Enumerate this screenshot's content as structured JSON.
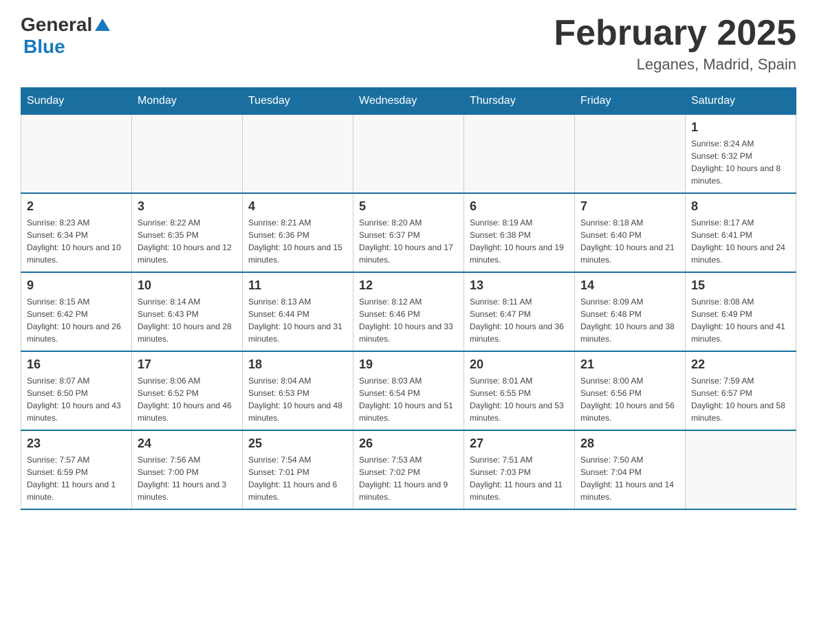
{
  "header": {
    "logo_general": "General",
    "logo_blue": "Blue",
    "month_title": "February 2025",
    "location": "Leganes, Madrid, Spain"
  },
  "days_of_week": [
    "Sunday",
    "Monday",
    "Tuesday",
    "Wednesday",
    "Thursday",
    "Friday",
    "Saturday"
  ],
  "weeks": [
    {
      "cells": [
        {
          "day": "",
          "info": ""
        },
        {
          "day": "",
          "info": ""
        },
        {
          "day": "",
          "info": ""
        },
        {
          "day": "",
          "info": ""
        },
        {
          "day": "",
          "info": ""
        },
        {
          "day": "",
          "info": ""
        },
        {
          "day": "1",
          "info": "Sunrise: 8:24 AM\nSunset: 6:32 PM\nDaylight: 10 hours and 8 minutes."
        }
      ]
    },
    {
      "cells": [
        {
          "day": "2",
          "info": "Sunrise: 8:23 AM\nSunset: 6:34 PM\nDaylight: 10 hours and 10 minutes."
        },
        {
          "day": "3",
          "info": "Sunrise: 8:22 AM\nSunset: 6:35 PM\nDaylight: 10 hours and 12 minutes."
        },
        {
          "day": "4",
          "info": "Sunrise: 8:21 AM\nSunset: 6:36 PM\nDaylight: 10 hours and 15 minutes."
        },
        {
          "day": "5",
          "info": "Sunrise: 8:20 AM\nSunset: 6:37 PM\nDaylight: 10 hours and 17 minutes."
        },
        {
          "day": "6",
          "info": "Sunrise: 8:19 AM\nSunset: 6:38 PM\nDaylight: 10 hours and 19 minutes."
        },
        {
          "day": "7",
          "info": "Sunrise: 8:18 AM\nSunset: 6:40 PM\nDaylight: 10 hours and 21 minutes."
        },
        {
          "day": "8",
          "info": "Sunrise: 8:17 AM\nSunset: 6:41 PM\nDaylight: 10 hours and 24 minutes."
        }
      ]
    },
    {
      "cells": [
        {
          "day": "9",
          "info": "Sunrise: 8:15 AM\nSunset: 6:42 PM\nDaylight: 10 hours and 26 minutes."
        },
        {
          "day": "10",
          "info": "Sunrise: 8:14 AM\nSunset: 6:43 PM\nDaylight: 10 hours and 28 minutes."
        },
        {
          "day": "11",
          "info": "Sunrise: 8:13 AM\nSunset: 6:44 PM\nDaylight: 10 hours and 31 minutes."
        },
        {
          "day": "12",
          "info": "Sunrise: 8:12 AM\nSunset: 6:46 PM\nDaylight: 10 hours and 33 minutes."
        },
        {
          "day": "13",
          "info": "Sunrise: 8:11 AM\nSunset: 6:47 PM\nDaylight: 10 hours and 36 minutes."
        },
        {
          "day": "14",
          "info": "Sunrise: 8:09 AM\nSunset: 6:48 PM\nDaylight: 10 hours and 38 minutes."
        },
        {
          "day": "15",
          "info": "Sunrise: 8:08 AM\nSunset: 6:49 PM\nDaylight: 10 hours and 41 minutes."
        }
      ]
    },
    {
      "cells": [
        {
          "day": "16",
          "info": "Sunrise: 8:07 AM\nSunset: 6:50 PM\nDaylight: 10 hours and 43 minutes."
        },
        {
          "day": "17",
          "info": "Sunrise: 8:06 AM\nSunset: 6:52 PM\nDaylight: 10 hours and 46 minutes."
        },
        {
          "day": "18",
          "info": "Sunrise: 8:04 AM\nSunset: 6:53 PM\nDaylight: 10 hours and 48 minutes."
        },
        {
          "day": "19",
          "info": "Sunrise: 8:03 AM\nSunset: 6:54 PM\nDaylight: 10 hours and 51 minutes."
        },
        {
          "day": "20",
          "info": "Sunrise: 8:01 AM\nSunset: 6:55 PM\nDaylight: 10 hours and 53 minutes."
        },
        {
          "day": "21",
          "info": "Sunrise: 8:00 AM\nSunset: 6:56 PM\nDaylight: 10 hours and 56 minutes."
        },
        {
          "day": "22",
          "info": "Sunrise: 7:59 AM\nSunset: 6:57 PM\nDaylight: 10 hours and 58 minutes."
        }
      ]
    },
    {
      "cells": [
        {
          "day": "23",
          "info": "Sunrise: 7:57 AM\nSunset: 6:59 PM\nDaylight: 11 hours and 1 minute."
        },
        {
          "day": "24",
          "info": "Sunrise: 7:56 AM\nSunset: 7:00 PM\nDaylight: 11 hours and 3 minutes."
        },
        {
          "day": "25",
          "info": "Sunrise: 7:54 AM\nSunset: 7:01 PM\nDaylight: 11 hours and 6 minutes."
        },
        {
          "day": "26",
          "info": "Sunrise: 7:53 AM\nSunset: 7:02 PM\nDaylight: 11 hours and 9 minutes."
        },
        {
          "day": "27",
          "info": "Sunrise: 7:51 AM\nSunset: 7:03 PM\nDaylight: 11 hours and 11 minutes."
        },
        {
          "day": "28",
          "info": "Sunrise: 7:50 AM\nSunset: 7:04 PM\nDaylight: 11 hours and 14 minutes."
        },
        {
          "day": "",
          "info": ""
        }
      ]
    }
  ]
}
